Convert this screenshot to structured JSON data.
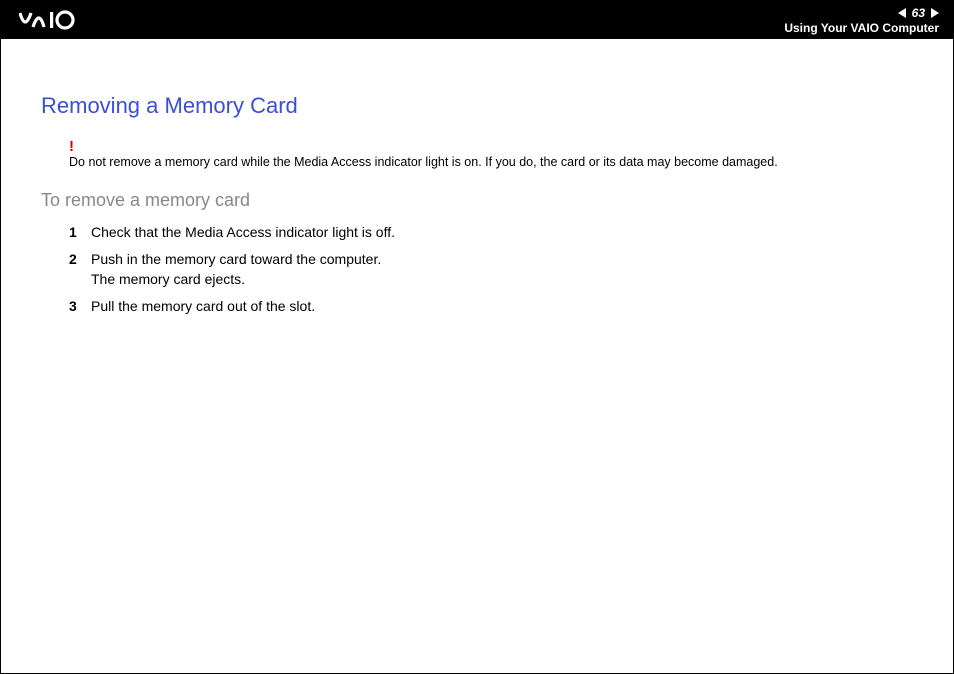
{
  "header": {
    "page_number": "63",
    "section_title": "Using Your VAIO Computer"
  },
  "content": {
    "heading": "Removing a Memory Card",
    "warning": {
      "text": "Do not remove a memory card while the Media Access indicator light is on. If you do, the card or its data may become damaged."
    },
    "subheading": "To remove a memory card",
    "steps": [
      {
        "num": "1",
        "text": "Check that the Media Access indicator light is off."
      },
      {
        "num": "2",
        "text": "Push in the memory card toward the computer.\nThe memory card ejects."
      },
      {
        "num": "3",
        "text": "Pull the memory card out of the slot."
      }
    ]
  }
}
